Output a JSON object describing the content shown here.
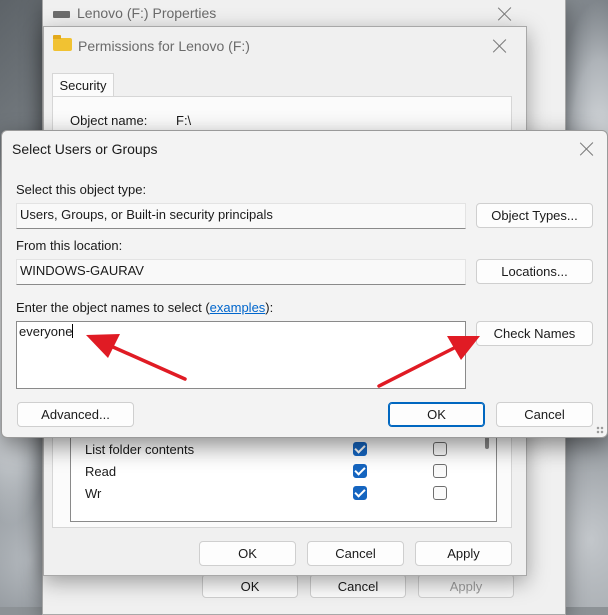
{
  "properties_window": {
    "title": "Lenovo (F:) Properties",
    "ok_label": "OK",
    "cancel_label": "Cancel",
    "apply_label": "Apply"
  },
  "permissions_window": {
    "title": "Permissions for Lenovo (F:)",
    "tab_security": "Security",
    "object_name_label": "Object name:",
    "object_name_value": "F:\\",
    "permissions": [
      {
        "name": "List folder contents",
        "allow": true,
        "deny": false
      },
      {
        "name": "Read",
        "allow": true,
        "deny": false
      },
      {
        "name": "Wr",
        "allow": true,
        "deny": false
      }
    ],
    "ok_label": "OK",
    "cancel_label": "Cancel",
    "apply_label": "Apply"
  },
  "dialog": {
    "title": "Select Users or Groups",
    "object_type_label": "Select this object type:",
    "object_type_value": "Users, Groups, or Built-in security principals",
    "object_types_button": "Object Types...",
    "location_label": "From this location:",
    "location_value": "WINDOWS-GAURAV",
    "locations_button": "Locations...",
    "names_label_prefix": "Enter the object names to select (",
    "names_label_link": "examples",
    "names_label_suffix": "):",
    "names_value": "everyone",
    "check_names_button": "Check Names",
    "advanced_button": "Advanced...",
    "ok_button": "OK",
    "cancel_button": "Cancel"
  },
  "colors": {
    "accent": "#0067c0",
    "annotation_arrow": "#e01b24",
    "link": "#0066cc"
  },
  "icons": {
    "drive": "drive-icon",
    "folder": "folder-icon",
    "close": "close-icon"
  }
}
